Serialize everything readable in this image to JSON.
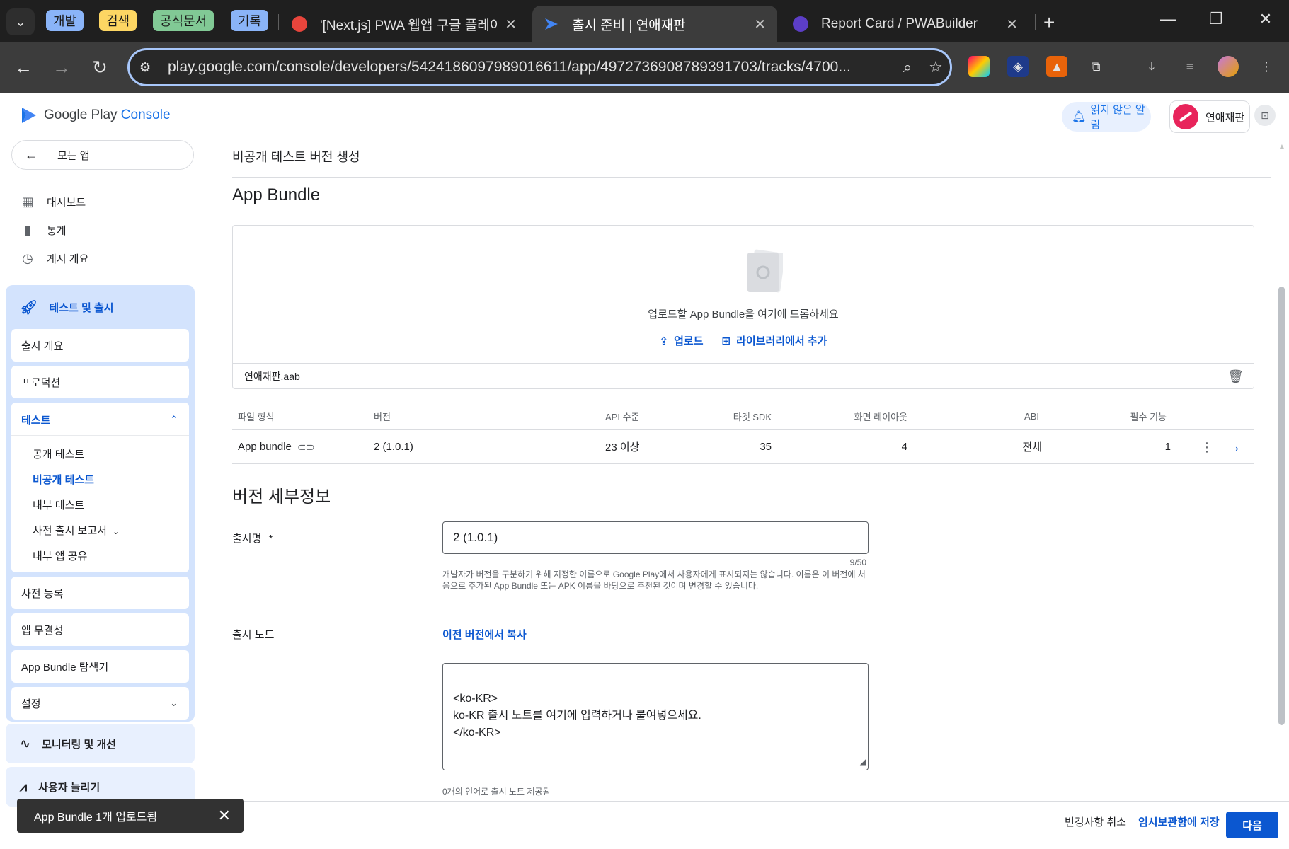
{
  "browser": {
    "tab_groups": [
      {
        "label": "개발",
        "color": "#8ab4f8"
      },
      {
        "label": "검색",
        "color": "#fdd663"
      },
      {
        "label": "공식문서",
        "color": "#81c995"
      },
      {
        "label": "기록",
        "color": "#8ab4f8"
      }
    ],
    "tabs": [
      {
        "title": "'[Next.js] PWA 웹앱 구글 플레이",
        "active": false
      },
      {
        "title": "출시 준비 | 연애재판",
        "active": true
      },
      {
        "title": "Report Card / PWABuilder",
        "active": false
      }
    ],
    "url": "play.google.com/console/developers/5424186097989016611/app/4972736908789391703/tracks/4700..."
  },
  "console": {
    "logo_prefix": "Google Play",
    "logo_suffix": " Console",
    "unread_notifications": "읽지 않은 알림",
    "developer_name": "연애재판"
  },
  "sidebar": {
    "back_label": "모든 앱",
    "top_items": [
      {
        "label": "대시보드",
        "icon": "dashboard-icon"
      },
      {
        "label": "통계",
        "icon": "bar-chart-icon"
      },
      {
        "label": "게시 개요",
        "icon": "history-icon"
      }
    ],
    "section_label": "테스트 및 출시",
    "section_items": {
      "release_overview": "출시 개요",
      "production": "프로덕션",
      "testing": "테스트",
      "testing_children": [
        "공개 테스트",
        "비공개 테스트",
        "내부 테스트",
        "사전 출시 보고서",
        "내부 앱 공유"
      ],
      "pre_registration": "사전 등록",
      "app_integrity": "앱 무결성",
      "bundle_explorer": "App Bundle 탐색기",
      "settings": "설정"
    },
    "active_child": "비공개 테스트",
    "monitoring_label": "모니터링 및 개선",
    "grow_label": "사용자 늘리기"
  },
  "main": {
    "page_title": "비공개 테스트 버전 생성",
    "app_bundle_heading": "App Bundle",
    "drop_text": "업로드할 App Bundle을 여기에 드롭하세요",
    "upload_label": "업로드",
    "library_label": "라이브러리에서 추가",
    "file_name": "연애재판.aab",
    "table": {
      "headers": [
        "파일 형식",
        "버전",
        "API 수준",
        "타겟 SDK",
        "화면 레이아웃",
        "ABI",
        "필수 기능"
      ],
      "rows": [
        {
          "type": "App bundle",
          "version": "2 (1.0.1)",
          "api": "23 이상",
          "target_sdk": "35",
          "layouts": "4",
          "abi": "전체",
          "features": "1"
        }
      ]
    },
    "release_details_heading": "버전 세부정보",
    "release_name_label": "출시명",
    "release_name_required": "*",
    "release_name_value": "2 (1.0.1)",
    "release_name_counter": "9/50",
    "release_name_help": "개발자가 버전을 구분하기 위해 지정한 이름으로 Google Play에서 사용자에게 표시되지는 않습니다. 이름은 이 버전에 처음으로 추가된 App Bundle 또는 APK 이름을 바탕으로 추천된 것이며 변경할 수 있습니다.",
    "release_notes_label": "출시 노트",
    "copy_previous_label": "이전 버전에서 복사",
    "release_notes_value": "<ko-KR>\nko-KR 출시 노트를 여기에 입력하거나 붙여넣으세요.\n</ko-KR>",
    "release_notes_status": "0개의 언어로 출시 노트 제공됨"
  },
  "footer": {
    "discard": "변경사항 취소",
    "save_draft": "임시보관함에 저장",
    "next": "다음"
  },
  "snackbar": {
    "message": "App Bundle 1개 업로드됨"
  },
  "colors": {
    "accent": "#0b57d0",
    "chrome_dark": "#1f1f1f",
    "sidebar_active_bg": "#d3e3fd"
  }
}
